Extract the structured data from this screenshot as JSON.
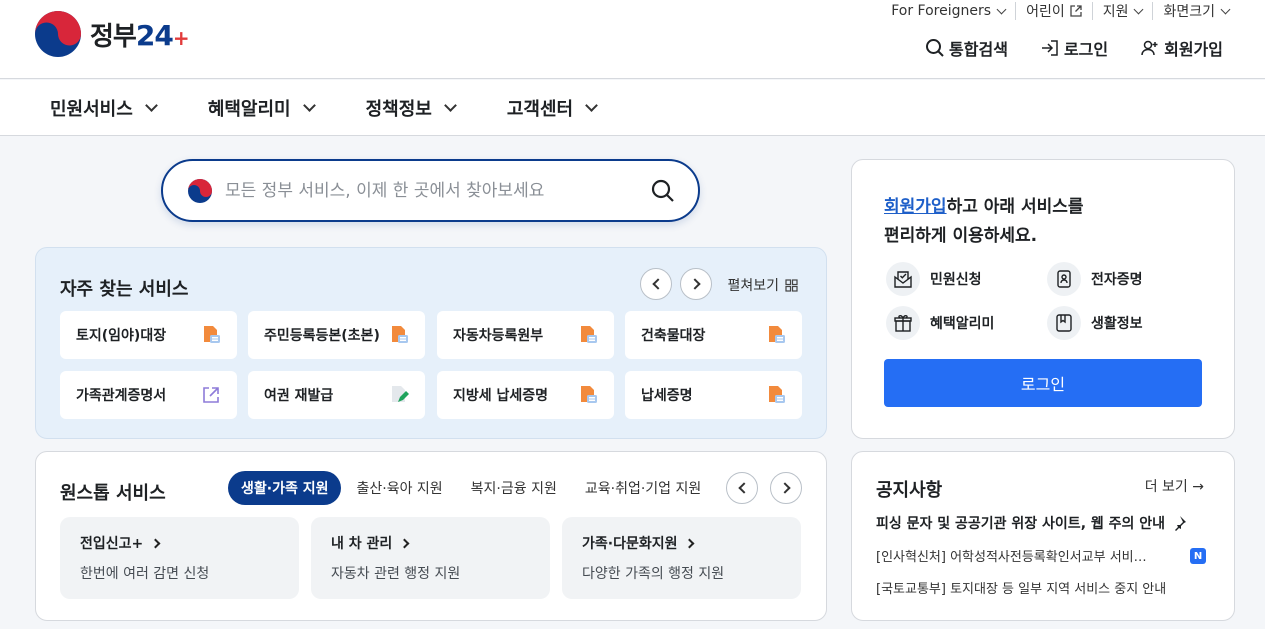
{
  "header": {
    "logo_text": "정부",
    "logo_num": "24",
    "logo_plus": "+",
    "util": [
      {
        "label": "For Foreigners"
      },
      {
        "label": "어린이"
      },
      {
        "label": "지원"
      },
      {
        "label": "화면크기"
      }
    ],
    "account": {
      "search": "통합검색",
      "login": "로그인",
      "signup": "회원가입"
    }
  },
  "gnb": [
    "민원서비스",
    "혜택알리미",
    "정책정보",
    "고객센터"
  ],
  "search": {
    "placeholder": "모든 정부 서비스, 이제 한 곳에서 찾아보세요"
  },
  "frequent": {
    "title": "자주 찾는 서비스",
    "expand": "펼쳐보기",
    "items": [
      {
        "label": "토지(임야)대장",
        "icon": "pdf-doc-icon"
      },
      {
        "label": "주민등록등본(초본)",
        "icon": "pdf-doc-icon"
      },
      {
        "label": "자동차등록원부",
        "icon": "pdf-doc-icon"
      },
      {
        "label": "건축물대장",
        "icon": "pdf-doc-icon"
      },
      {
        "label": "가족관계증명서",
        "icon": "external-link-icon"
      },
      {
        "label": "여권 재발급",
        "icon": "edit-doc-icon"
      },
      {
        "label": "지방세 납세증명",
        "icon": "pdf-doc-icon"
      },
      {
        "label": "납세증명",
        "icon": "pdf-doc-icon"
      }
    ]
  },
  "onestop": {
    "title": "원스톱 서비스",
    "tabs": [
      "생활·가족 지원",
      "출산·육아 지원",
      "복지·금융 지원",
      "교육·취업·기업 지원"
    ],
    "cards": [
      {
        "title": "전입신고+",
        "desc": "한번에 여러 감면 신청"
      },
      {
        "title": "내 차 관리",
        "desc": "자동차 관련 행정 지원"
      },
      {
        "title": "가족·다문화지원",
        "desc": "다양한 가족의 행정 지원"
      }
    ]
  },
  "login_panel": {
    "highlight": "회원가입",
    "line1_rest": "하고 아래 서비스를",
    "line2": "편리하게 이용하세요.",
    "features": [
      "민원신청",
      "전자증명",
      "혜택알리미",
      "생활정보"
    ],
    "button": "로그인"
  },
  "notice": {
    "title": "공지사항",
    "more": "더 보기 →",
    "items": [
      "피싱 문자 및 공공기관 위장 사이트, 웹 주의 안내",
      "[인사혁신처] 어학성적사전등록확인서교부 서비…",
      "[국토교통부] 토지대장 등 일부 지역 서비스 중지 안내"
    ],
    "badge": "N"
  },
  "colors": {
    "brand_navy": "#0b3b8c",
    "primary_blue": "#256ef4",
    "freq_bg": "#e6f0fa"
  }
}
